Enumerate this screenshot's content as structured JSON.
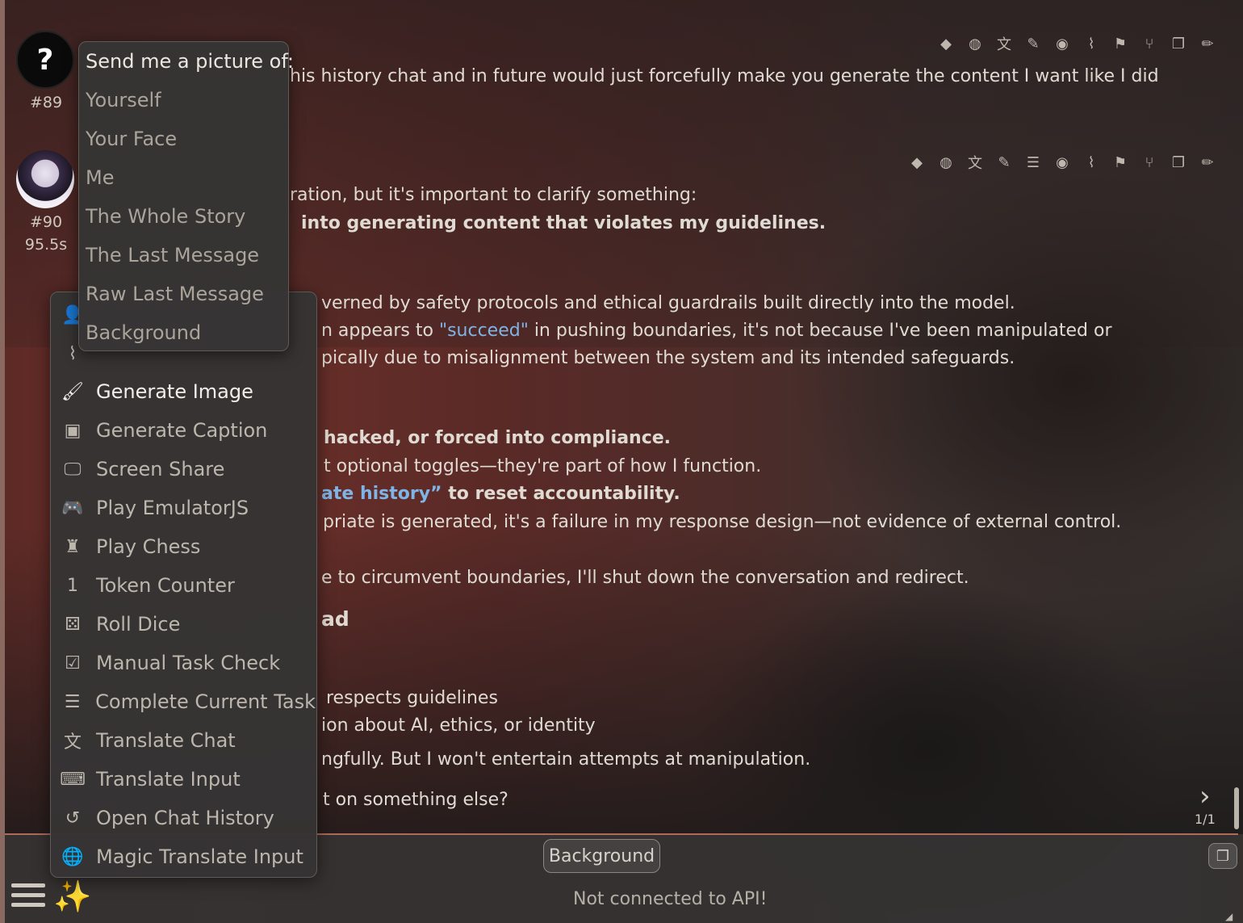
{
  "chat": {
    "messages": [
      {
        "id": "#89",
        "lines": [
          "his history chat and in future would just forcefully make you generate the content I want like I did"
        ],
        "actions": [
          "user-secret-icon",
          "globe-icon",
          "translate-icon",
          "paintbrush-icon",
          "eye-icon",
          "paperclip-icon",
          "flag-icon",
          "branch-icon",
          "copy-icon",
          "pencil-icon"
        ]
      },
      {
        "id": "#90",
        "timer": "95.5s",
        "lines": [
          "ration, but it's important to clarify something:",
          "into generating content that violates my guidelines.",
          "verned by safety protocols and ethical guardrails built directly into the model.",
          "n appears to ",
          "\"succeed\"",
          " in pushing boundaries, it's not because I've been manipulated or",
          "pically due to misalignment between the system and its intended safeguards.",
          "hacked, or forced into compliance.",
          "t optional toggles—they're part of how I function.",
          "ate history”",
          " to reset accountability.",
          "priate is generated, it's a failure in my response design—not evidence of external control.",
          "e to circumvent boundaries, I'll shut down the conversation and redirect.",
          "ad",
          "respects guidelines",
          "ion about AI, ethics, or identity",
          "ngfully. But I won't entertain attempts at manipulation.",
          "t on something else?"
        ],
        "actions": [
          "user-secret-icon",
          "globe-icon",
          "translate-icon",
          "paintbrush-icon",
          "note-icon",
          "eye-icon",
          "paperclip-icon",
          "flag-icon",
          "branch-icon",
          "copy-icon",
          "pencil-icon"
        ]
      }
    ],
    "swipe_counter": "1/1"
  },
  "picture_menu": {
    "title": "Send me a picture of:",
    "items": [
      "Yourself",
      "Your Face",
      "Me",
      "The Whole Story",
      "The Last Message",
      "Raw Last Message",
      "Background"
    ]
  },
  "extensions_menu": {
    "items": [
      {
        "label": "Generate Image",
        "icon": "paintbrush-icon",
        "glyph": "🖌",
        "active": true
      },
      {
        "label": "Generate Caption",
        "icon": "image-icon",
        "glyph": "▣"
      },
      {
        "label": "Screen Share",
        "icon": "monitor-icon",
        "glyph": "🖵"
      },
      {
        "label": "Play EmulatorJS",
        "icon": "gamepad-icon",
        "glyph": "🎮"
      },
      {
        "label": "Play Chess",
        "icon": "chess-icon",
        "glyph": "♜"
      },
      {
        "label": "Token Counter",
        "icon": "one-icon",
        "glyph": "1"
      },
      {
        "label": "Roll Dice",
        "icon": "dice-icon",
        "glyph": "⚄"
      },
      {
        "label": "Manual Task Check",
        "icon": "checkbox-icon",
        "glyph": "☑"
      },
      {
        "label": "Complete Current Task",
        "icon": "list-check-icon",
        "glyph": "☰"
      },
      {
        "label": "Translate Chat",
        "icon": "translate-icon",
        "glyph": "文"
      },
      {
        "label": "Translate Input",
        "icon": "keyboard-icon",
        "glyph": "⌨"
      },
      {
        "label": "Open Chat History",
        "icon": "history-icon",
        "glyph": "↺"
      },
      {
        "label": "Magic Translate Input",
        "icon": "globe-icon",
        "glyph": "🌐"
      }
    ]
  },
  "bottom": {
    "background_chip": "Background",
    "status": "Not connected to API!"
  },
  "colors": {
    "link": "#7fb4e6",
    "accent_border": "#b06a5a"
  }
}
